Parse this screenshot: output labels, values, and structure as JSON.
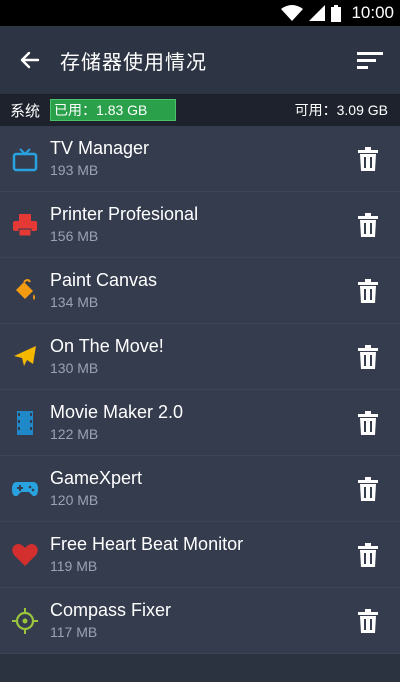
{
  "status_bar": {
    "time": "10:00"
  },
  "header": {
    "title": "存储器使用情况"
  },
  "storage": {
    "label": "系统",
    "used": "已用：1.83 GB",
    "available": "可用：3.09 GB"
  },
  "apps": [
    {
      "name": "TV Manager",
      "size": "193 MB",
      "icon": "tv-icon",
      "color": "#29a3e0"
    },
    {
      "name": "Printer Profesional",
      "size": "156 MB",
      "icon": "printer-icon",
      "color": "#e53935"
    },
    {
      "name": "Paint Canvas",
      "size": "134 MB",
      "icon": "paint-bucket-icon",
      "color": "#f39c12"
    },
    {
      "name": "On The Move!",
      "size": "130 MB",
      "icon": "airplane-icon",
      "color": "#f5b800"
    },
    {
      "name": "Movie Maker 2.0",
      "size": "122 MB",
      "icon": "film-icon",
      "color": "#1e88c8"
    },
    {
      "name": "GameXpert",
      "size": "120 MB",
      "icon": "gamepad-icon",
      "color": "#29a3e0"
    },
    {
      "name": "Free Heart Beat Monitor",
      "size": "119 MB",
      "icon": "heart-icon",
      "color": "#d32f2f"
    },
    {
      "name": "Compass Fixer",
      "size": "117 MB",
      "icon": "compass-icon",
      "color": "#9bc53d"
    }
  ],
  "colors": {
    "used_bar": "#2aa04a",
    "background": "#2b3240",
    "row": "#343c4d"
  }
}
